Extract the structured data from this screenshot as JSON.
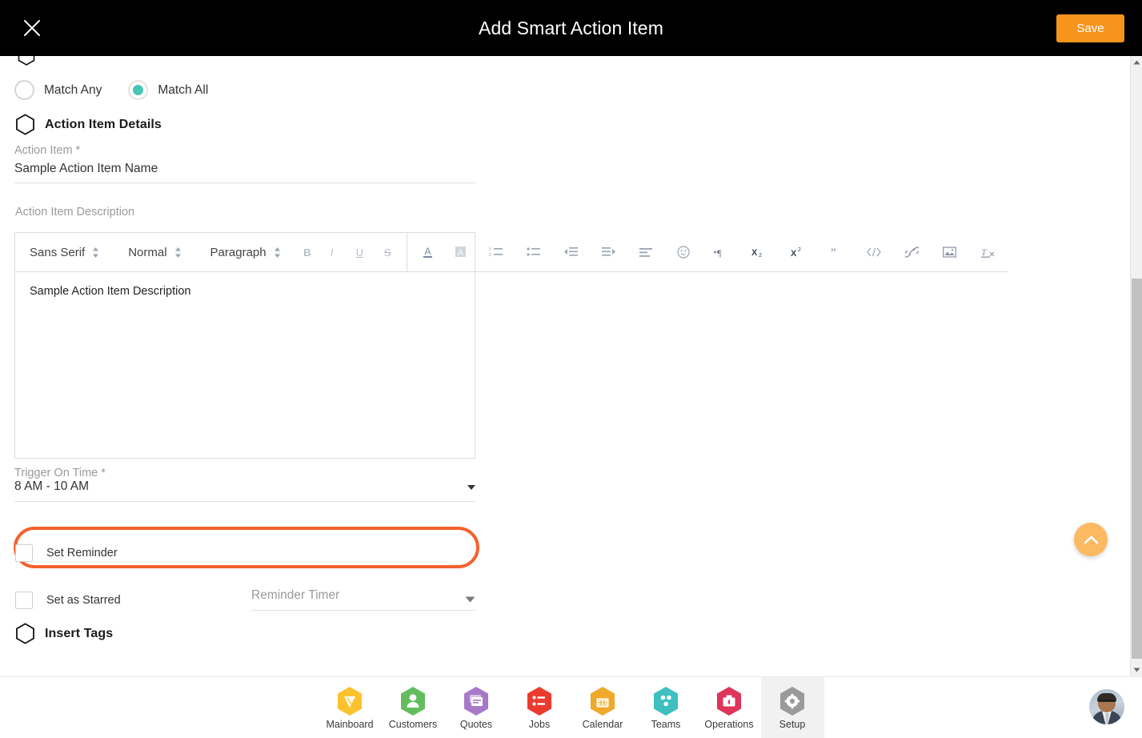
{
  "header": {
    "title": "Add Smart Action Item",
    "save_label": "Save",
    "close_icon": "close-icon"
  },
  "match_options": {
    "any_label": "Match Any",
    "all_label": "Match All",
    "selected": "Match All",
    "accent_color": "#49c5b6"
  },
  "sections": {
    "action_item_details": "Action Item Details",
    "insert_tags": "Insert Tags"
  },
  "fields": {
    "action_item": {
      "label": "Action Item *",
      "value": "Sample Action Item Name"
    },
    "action_item_description": {
      "label": "Action Item Description",
      "value": "Sample Action Item Description"
    },
    "trigger_on_time": {
      "label": "Trigger On Time *",
      "value": "8 AM - 10 AM",
      "highlight_color": "#f4622c"
    },
    "reminder_timer": {
      "placeholder": "Reminder Timer",
      "value": ""
    }
  },
  "checkboxes": [
    {
      "label": "Set Reminder",
      "checked": false
    },
    {
      "label": "Set as Starred",
      "checked": false
    }
  ],
  "editor_toolbar": {
    "font_family": "Sans Serif",
    "font_size": "Normal",
    "block_format": "Paragraph",
    "buttons": [
      {
        "name": "bold-icon",
        "glyph": "B"
      },
      {
        "name": "italic-icon",
        "glyph": "I"
      },
      {
        "name": "underline-icon",
        "glyph": "U"
      },
      {
        "name": "strikethrough-icon",
        "glyph": "S"
      },
      {
        "name": "text-color-icon",
        "glyph": "A"
      },
      {
        "name": "background-color-icon",
        "glyph": "A"
      },
      {
        "name": "ordered-list-icon",
        "glyph": ""
      },
      {
        "name": "bullet-list-icon",
        "glyph": ""
      },
      {
        "name": "outdent-icon",
        "glyph": ""
      },
      {
        "name": "indent-icon",
        "glyph": ""
      },
      {
        "name": "align-icon",
        "glyph": ""
      },
      {
        "name": "emoji-icon",
        "glyph": "☺"
      },
      {
        "name": "text-direction-icon",
        "glyph": "¶"
      },
      {
        "name": "subscript-icon",
        "glyph": "X₂"
      },
      {
        "name": "superscript-icon",
        "glyph": "X²"
      },
      {
        "name": "blockquote-icon",
        "glyph": "”"
      },
      {
        "name": "code-block-icon",
        "glyph": "</>"
      },
      {
        "name": "link-icon",
        "glyph": "🔗"
      },
      {
        "name": "image-icon",
        "glyph": "🖼"
      },
      {
        "name": "clear-format-icon",
        "glyph": "Tx"
      }
    ]
  },
  "fab": {
    "name": "scroll-to-top-button",
    "icon": "chevron-up-icon",
    "color": "#fbb962"
  },
  "bottom_nav": {
    "active": "Setup",
    "items": [
      {
        "label": "Mainboard",
        "icon": "mainboard-icon",
        "color": "#fcc22d"
      },
      {
        "label": "Customers",
        "icon": "customers-icon",
        "color": "#63bd5f"
      },
      {
        "label": "Quotes",
        "icon": "quotes-icon",
        "color": "#a878c8"
      },
      {
        "label": "Jobs",
        "icon": "jobs-icon",
        "color": "#eb3b2e"
      },
      {
        "label": "Calendar",
        "icon": "calendar-icon",
        "color": "#f0a92b"
      },
      {
        "label": "Teams",
        "icon": "teams-icon",
        "color": "#3fbfc0"
      },
      {
        "label": "Operations",
        "icon": "operations-icon",
        "color": "#e0345a"
      },
      {
        "label": "Setup",
        "icon": "gear-icon",
        "color": "#9a9a9a"
      }
    ]
  }
}
